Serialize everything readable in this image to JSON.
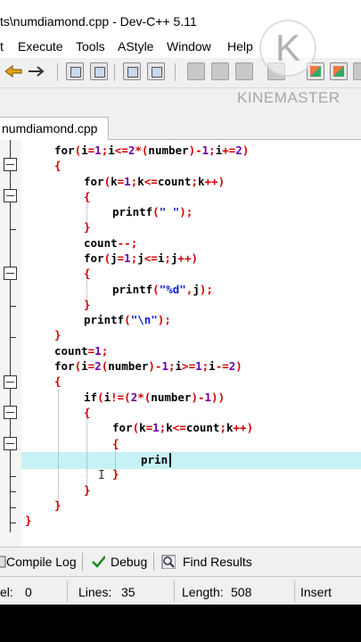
{
  "window": {
    "title": "ts\\numdiamond.cpp - Dev-C++ 5.11"
  },
  "menu": [
    "t",
    "Execute",
    "Tools",
    "AStyle",
    "Window",
    "Help"
  ],
  "watermark": {
    "letter": "K",
    "text": "KINEMASTER"
  },
  "editor_tab": {
    "label": "numdiamond.cpp"
  },
  "code": [
    "for(i=1;i<=2*(number)-1;i+=2)",
    "{",
    "for(k=1;k<=count;k++)",
    "{",
    "printf(\" \");",
    "}",
    "count--;",
    "for(j=1;j<=i;j++)",
    "{",
    "printf(\"%d\",j);",
    "}",
    "printf(\"\\n\");",
    "}",
    "count=1;",
    "for(i=2(number)-1;i>=1;i-=2)",
    "{",
    "if(i!=(2*(number)-1))",
    "{",
    "for(k=1;k<=count;k++)",
    "{",
    "prin",
    "}",
    "}",
    "}",
    "}"
  ],
  "bottom_tabs": {
    "compile_log": "Compile Log",
    "debug": "Debug",
    "find_results": "Find Results"
  },
  "status": {
    "sel_label": "el:",
    "sel_value": "0",
    "lines_label": "Lines:",
    "lines_value": "35",
    "length_label": "Length:",
    "length_value": "508",
    "mode": "Insert"
  },
  "colors": {
    "keyword": "#000000",
    "operator": "#d40000",
    "number": "#6a00a8",
    "string": "#1020d0",
    "current_line": "#c6f2f6"
  }
}
